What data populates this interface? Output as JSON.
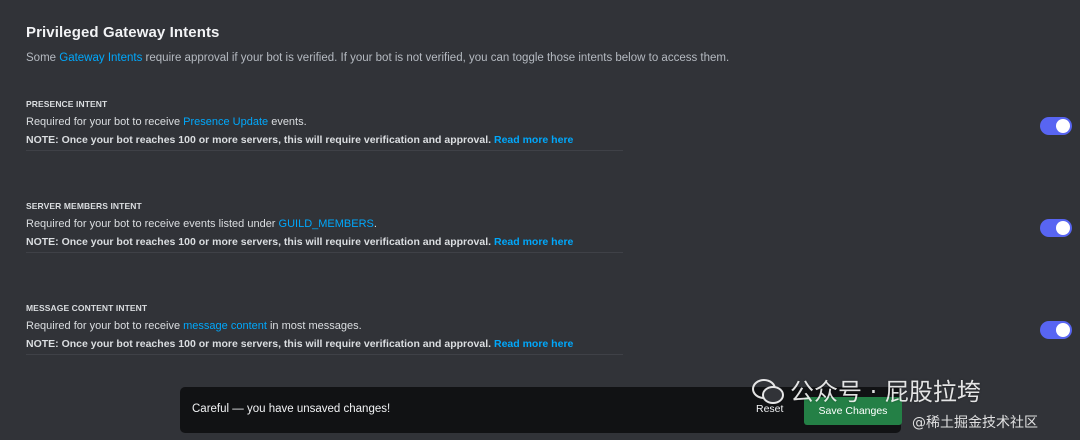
{
  "section": {
    "title": "Privileged Gateway Intents",
    "desc_prefix": "Some ",
    "desc_link": "Gateway Intents",
    "desc_suffix": " require approval if your bot is verified. If your bot is not verified, you can toggle those intents below to access them."
  },
  "intents": [
    {
      "label": "PRESENCE INTENT",
      "line1_prefix": "Required for your bot to receive ",
      "line1_link": "Presence Update",
      "line1_suffix": " events.",
      "note": "NOTE: Once your bot reaches 100 or more servers, this will require verification and approval.",
      "note_link": "Read more here",
      "enabled": true
    },
    {
      "label": "SERVER MEMBERS INTENT",
      "line1_prefix": "Required for your bot to receive events listed under ",
      "line1_link": "GUILD_MEMBERS",
      "line1_suffix": ".",
      "note": "NOTE: Once your bot reaches 100 or more servers, this will require verification and approval.",
      "note_link": "Read more here",
      "enabled": true
    },
    {
      "label": "MESSAGE CONTENT INTENT",
      "line1_prefix": "Required for your bot to receive ",
      "line1_link": "message content",
      "line1_suffix": " in most messages.",
      "note": "NOTE: Once your bot reaches 100 or more servers, this will require verification and approval.",
      "note_link": "Read more here",
      "enabled": true
    }
  ],
  "unsaved": {
    "message": "Careful — you have unsaved changes!",
    "reset_label": "Reset",
    "save_label": "Save Changes"
  },
  "watermark": {
    "top": "公众号 · 屁股拉垮",
    "bottom": "@稀土掘金技术社区"
  },
  "colors": {
    "background": "#313338",
    "link": "#00a8fc",
    "toggle_on": "#5865f2",
    "save_button": "#248046",
    "notice_bar": "#111214"
  }
}
